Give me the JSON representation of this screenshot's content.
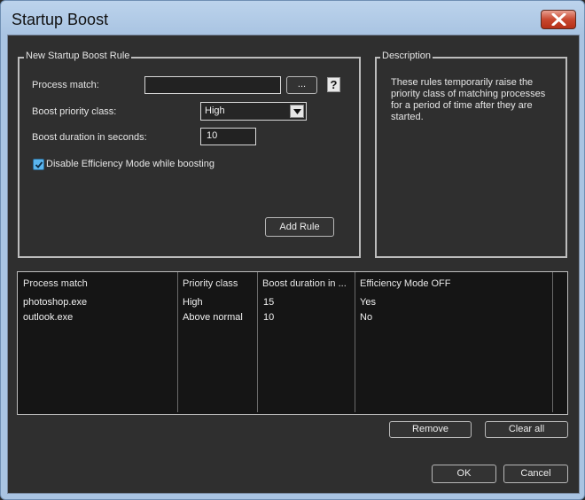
{
  "window": {
    "title": "Startup Boost"
  },
  "new_rule": {
    "group_title": "New Startup Boost Rule",
    "process_match_label": "Process match:",
    "process_match_value": "",
    "browse_label": "...",
    "help_label": "?",
    "priority_label": "Boost priority class:",
    "priority_selected": "High",
    "duration_label": "Boost duration in seconds:",
    "duration_value": "10",
    "disable_efficiency_label": "Disable Efficiency Mode while boosting",
    "disable_efficiency_checked": true,
    "add_rule_label": "Add Rule"
  },
  "description": {
    "group_title": "Description",
    "lines": [
      "These rules temporarily raise the",
      "priority class of matching processes",
      "for a period of time after they are",
      "started."
    ]
  },
  "rules_table": {
    "columns": [
      "Process match",
      "Priority class",
      "Boost duration in ...",
      "Efficiency Mode OFF"
    ],
    "rows": [
      [
        "photoshop.exe",
        "High",
        "15",
        "Yes"
      ],
      [
        "outlook.exe",
        "Above normal",
        "10",
        "No"
      ]
    ]
  },
  "buttons": {
    "remove": "Remove",
    "clear_all": "Clear all",
    "ok": "OK",
    "cancel": "Cancel"
  },
  "icons": [
    "close-icon",
    "chevron-down-icon",
    "checkmark-icon"
  ]
}
